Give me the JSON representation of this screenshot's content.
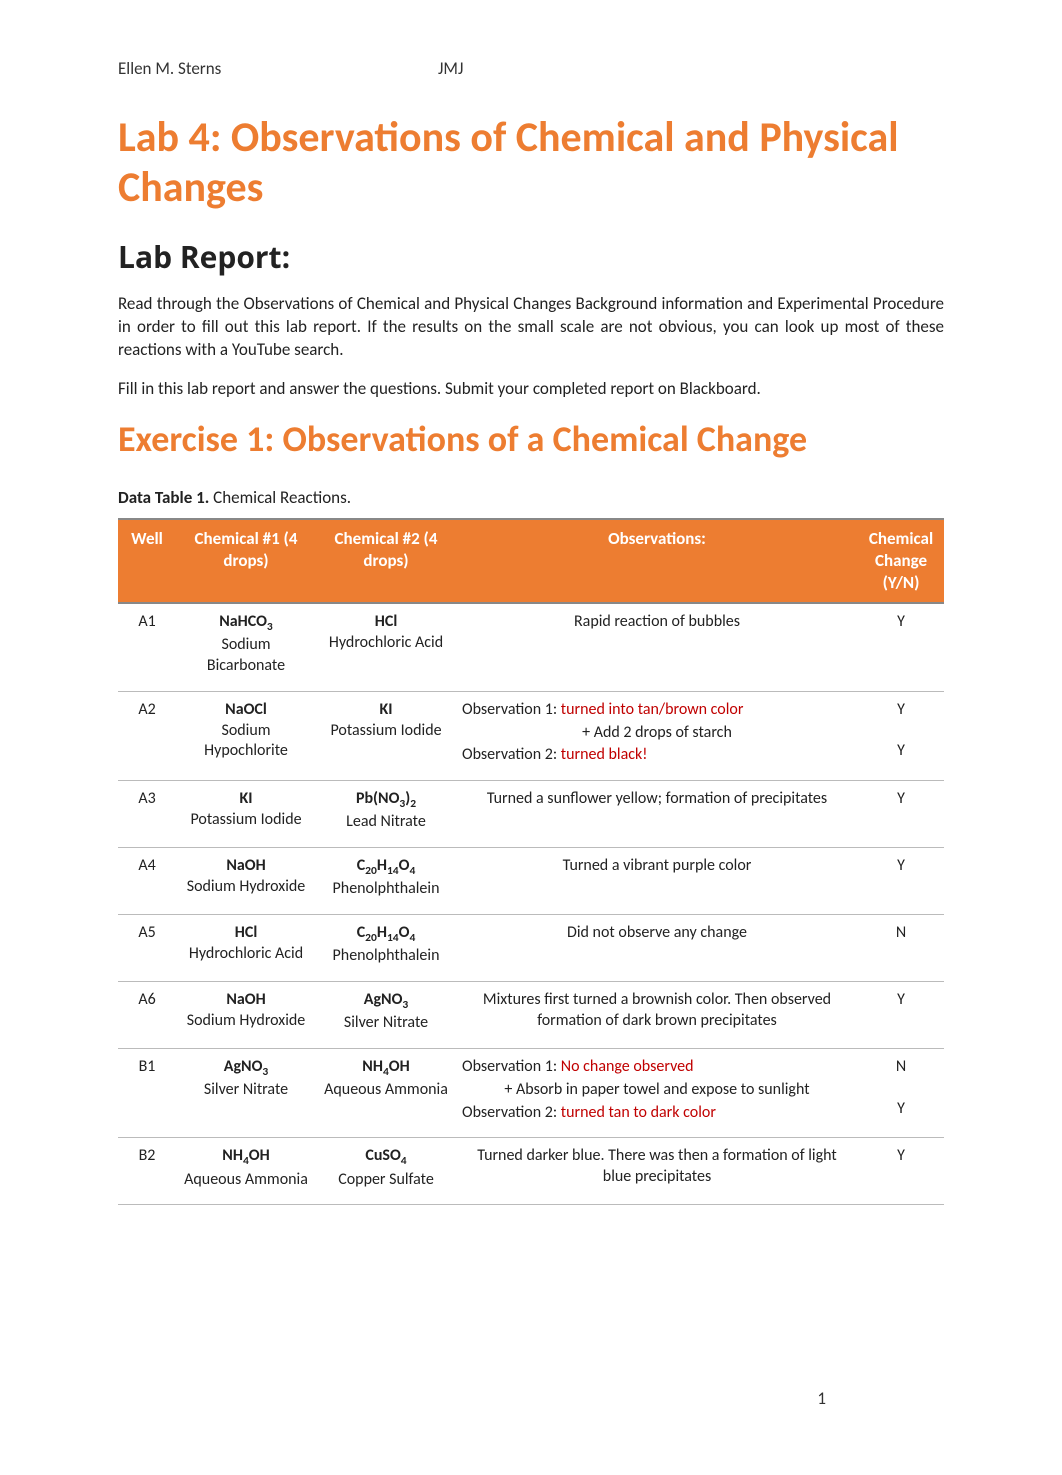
{
  "header": {
    "author": "Ellen M. Sterns",
    "center": "JMJ"
  },
  "title": "Lab 4:  Observations of Chemical and Physical Changes",
  "subtitle": "Lab Report:",
  "intro_p1": "Read through the Observations of Chemical and Physical Changes Background information and Experimental Procedure in order to fill out this lab report.  If the results on the small scale are not obvious, you can look up most of these reactions with a YouTube search.",
  "intro_p2": "Fill in this lab report and answer the questions.  Submit your completed report on Blackboard.",
  "exercise_title": "Exercise 1: Observations of a Chemical Change",
  "table_caption_bold": "Data Table 1.",
  "table_caption_rest": " Chemical Reactions.",
  "columns": {
    "well": "Well",
    "chem1": "Chemical #1 (4 drops)",
    "chem2": "Chemical #2 (4 drops)",
    "obs": "Observations:",
    "change": "Chemical Change (Y/N)"
  },
  "rows": [
    {
      "well": "A1",
      "chem1_formula_html": "NaHCO<sub>3</sub>",
      "chem1_name": "Sodium Bicarbonate",
      "chem2_formula_html": "HCl",
      "chem2_name": "Hydrochloric Acid",
      "observations": [
        {
          "text": "Rapid reaction of bubbles",
          "type": "plain"
        }
      ],
      "change": [
        "Y"
      ]
    },
    {
      "well": "A2",
      "chem1_formula_html": "NaOCl",
      "chem1_name": "Sodium Hypochlorite",
      "chem2_formula_html": "KI",
      "chem2_name": "Potassium Iodide",
      "observations": [
        {
          "prefix": "Observation 1: ",
          "text": "turned into tan/brown color",
          "type": "red"
        },
        {
          "text": "+ Add 2 drops of starch",
          "type": "step"
        },
        {
          "prefix": "Observation 2: ",
          "text": "turned black!",
          "type": "red"
        }
      ],
      "change": [
        "Y",
        "",
        "Y"
      ]
    },
    {
      "well": "A3",
      "chem1_formula_html": "KI",
      "chem1_name": "Potassium Iodide",
      "chem2_formula_html": "Pb(NO<sub>3</sub>)<sub>2</sub>",
      "chem2_name": "Lead Nitrate",
      "observations": [
        {
          "text": "Turned a sunflower yellow; formation of precipitates",
          "type": "plain"
        }
      ],
      "change": [
        "Y"
      ]
    },
    {
      "well": "A4",
      "chem1_formula_html": "NaOH",
      "chem1_name": "Sodium Hydroxide",
      "chem2_formula_html": "C<sub>20</sub>H<sub>14</sub>O<sub>4</sub>",
      "chem2_name": "Phenolphthalein",
      "observations": [
        {
          "text": "Turned a vibrant purple color",
          "type": "plain"
        }
      ],
      "change": [
        "Y"
      ]
    },
    {
      "well": "A5",
      "chem1_formula_html": "HCl",
      "chem1_name": "Hydrochloric Acid",
      "chem2_formula_html": "C<sub>20</sub>H<sub>14</sub>O<sub>4</sub>",
      "chem2_name": "Phenolphthalein",
      "observations": [
        {
          "text": "Did not observe any change",
          "type": "plain"
        }
      ],
      "change": [
        "N"
      ]
    },
    {
      "well": "A6",
      "chem1_formula_html": "NaOH",
      "chem1_name": "Sodium Hydroxide",
      "chem2_formula_html": "AgNO<sub>3</sub>",
      "chem2_name": "Silver Nitrate",
      "observations": [
        {
          "text": "Mixtures first turned a brownish color. Then observed formation of dark brown precipitates",
          "type": "plain"
        }
      ],
      "change": [
        "Y"
      ]
    },
    {
      "well": "B1",
      "chem1_formula_html": "AgNO<sub>3</sub>",
      "chem1_name": "Silver Nitrate",
      "chem2_formula_html": "NH<sub>4</sub>OH",
      "chem2_name": "Aqueous Ammonia",
      "observations": [
        {
          "prefix": "Observation 1: ",
          "text": "No change observed",
          "type": "red"
        },
        {
          "text": "+ Absorb in paper towel and expose to sunlight",
          "type": "step"
        },
        {
          "prefix": "Observation 2: ",
          "text": "turned tan to dark color",
          "type": "red"
        }
      ],
      "change": [
        "N",
        "",
        "Y"
      ]
    },
    {
      "well": "B2",
      "chem1_formula_html": "NH<sub>4</sub>OH",
      "chem1_name": "Aqueous Ammonia",
      "chem2_formula_html": "CuSO<sub>4</sub>",
      "chem2_name": "Copper Sulfate",
      "observations": [
        {
          "text": "Turned darker blue. There was then a formation of light blue precipitates",
          "type": "plain"
        }
      ],
      "change": [
        "Y"
      ]
    }
  ],
  "page_number": "1"
}
